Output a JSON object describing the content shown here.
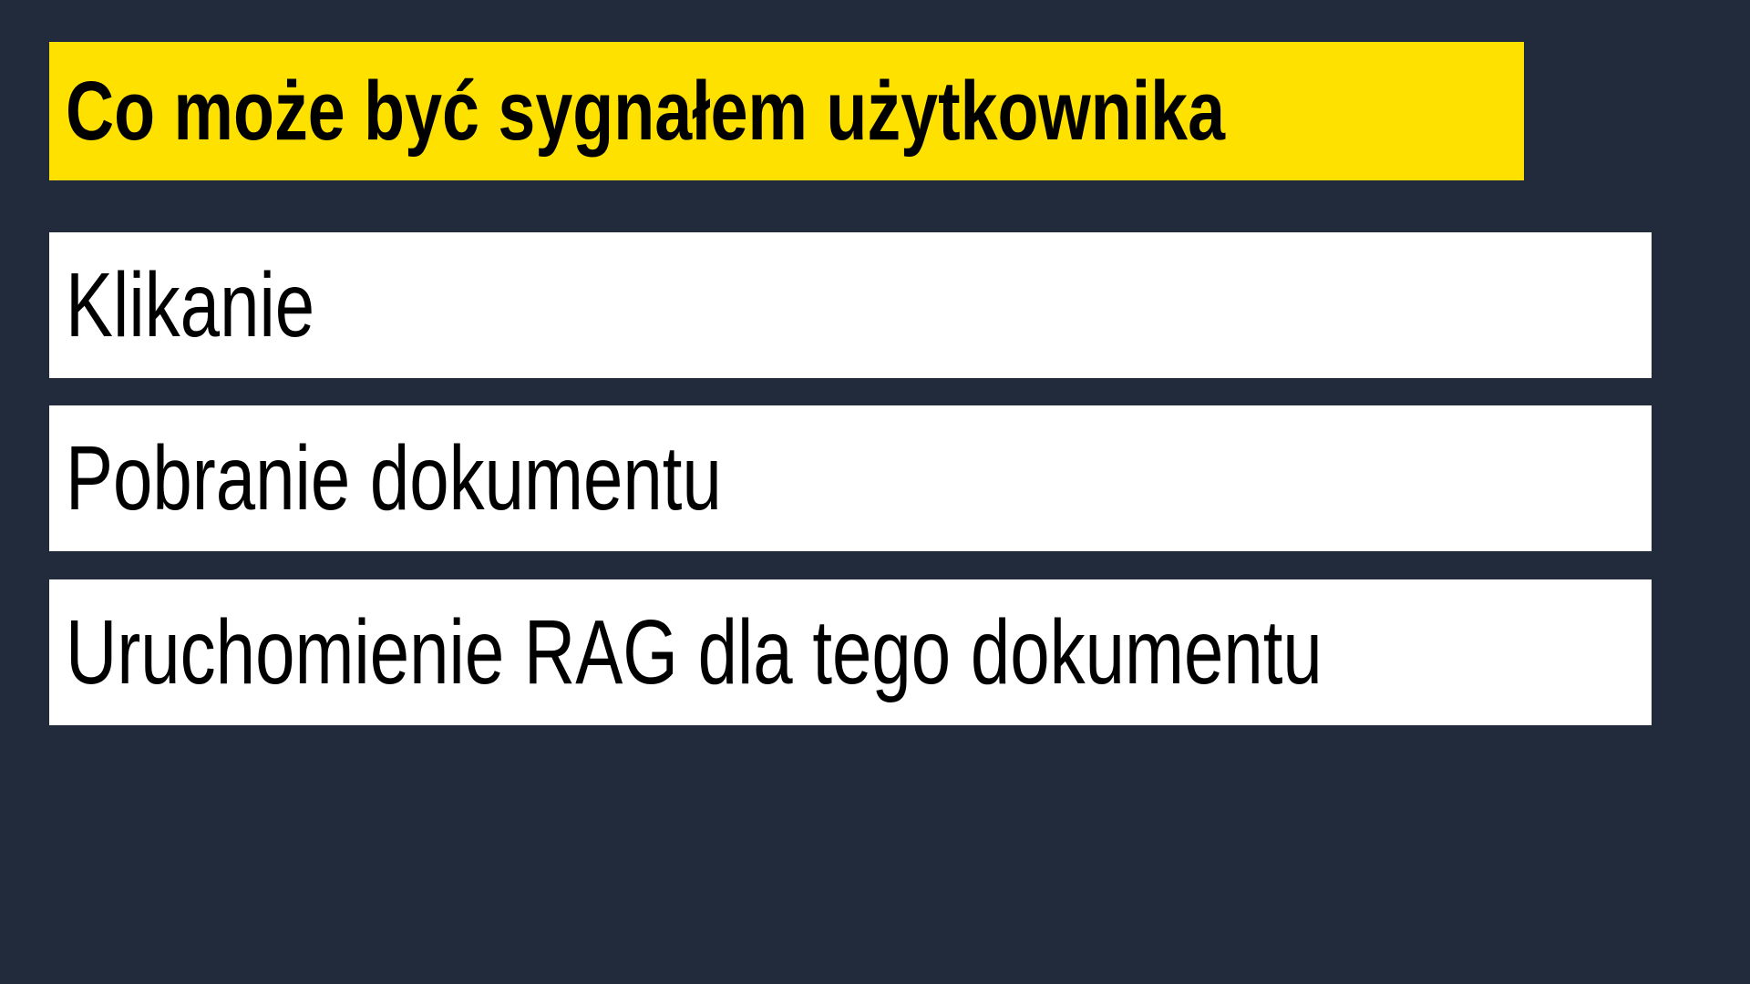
{
  "slide": {
    "title": "Co może być sygnałem użytkownika",
    "items": [
      {
        "label": "Klikanie"
      },
      {
        "label": "Pobranie dokumentu"
      },
      {
        "label": "Uruchomienie RAG dla tego dokumentu"
      }
    ]
  },
  "colors": {
    "background": "#212b3b",
    "title_background": "#ffe100",
    "item_background": "#ffffff",
    "text": "#000000"
  }
}
